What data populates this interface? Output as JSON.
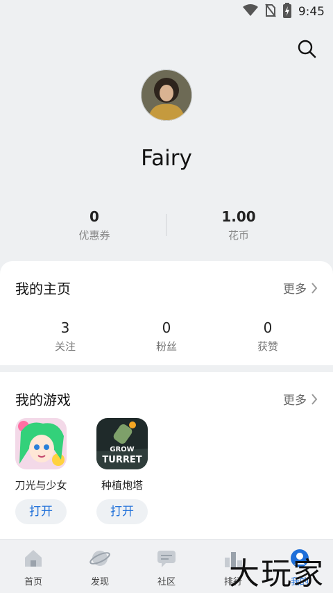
{
  "status_bar": {
    "time": "9:45",
    "icons": [
      "wifi-icon",
      "no-sim-icon",
      "battery-charging-icon"
    ]
  },
  "header": {
    "search_icon": "search-icon"
  },
  "profile": {
    "username": "Fairy",
    "avatar": "avatar"
  },
  "stats": [
    {
      "value": "0",
      "label": "优惠券"
    },
    {
      "value": "1.00",
      "label": "花币"
    }
  ],
  "homepage": {
    "title": "我的主页",
    "more": "更多",
    "items": [
      {
        "value": "3",
        "label": "关注"
      },
      {
        "value": "0",
        "label": "粉丝"
      },
      {
        "value": "0",
        "label": "获赞"
      }
    ]
  },
  "games": {
    "title": "我的游戏",
    "more": "更多",
    "items": [
      {
        "name": "刀光与少女",
        "action": "打开"
      },
      {
        "name": "种植炮塔",
        "action": "打开",
        "icon_text_1": "GROW",
        "icon_text_2": "TURRET"
      }
    ]
  },
  "tabbar": {
    "tabs": [
      {
        "label": "首页",
        "icon": "home-icon"
      },
      {
        "label": "发现",
        "icon": "planet-icon"
      },
      {
        "label": "社区",
        "icon": "chat-icon"
      },
      {
        "label": "排行",
        "icon": "rank-icon"
      },
      {
        "label": "我的",
        "icon": "profile-icon",
        "active": true
      }
    ]
  },
  "watermark": "大玩家",
  "colors": {
    "accent": "#1e6fd9",
    "background": "#eef0f2",
    "card": "#ffffff"
  }
}
